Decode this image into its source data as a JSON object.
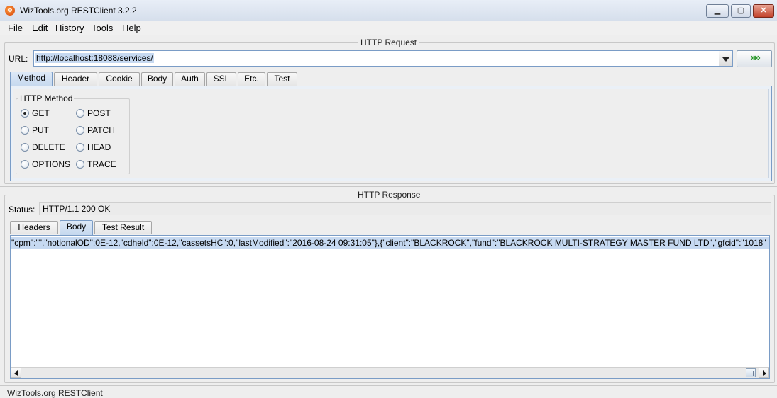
{
  "window": {
    "title": "WizTools.org RESTClient 3.2.2",
    "buttons": {
      "minimize": "▁",
      "maximize": "▢",
      "close": "✕"
    }
  },
  "menu": {
    "items": [
      "File",
      "Edit",
      "History",
      "Tools",
      "Help"
    ]
  },
  "request": {
    "section_title": "HTTP Request",
    "url_label": "URL:",
    "url_value": "http://localhost:18088/services/",
    "go_label": "»»",
    "tabs": [
      "Method",
      "Header",
      "Cookie",
      "Body",
      "Auth",
      "SSL",
      "Etc.",
      "Test"
    ],
    "active_tab": "Method",
    "method_group_title": "HTTP Method",
    "methods": [
      "GET",
      "POST",
      "PUT",
      "PATCH",
      "DELETE",
      "HEAD",
      "OPTIONS",
      "TRACE"
    ],
    "selected_method": "GET"
  },
  "response": {
    "section_title": "HTTP Response",
    "status_label": "Status:",
    "status_value": "HTTP/1.1 200 OK",
    "tabs": [
      "Headers",
      "Body",
      "Test Result"
    ],
    "active_tab": "Body",
    "body_text": "\"cpm\":\"\",\"notionalOD\":0E-12,\"cdheld\":0E-12,\"cassetsHC\":0,\"lastModified\":\"2016-08-24 09:31:05\"},{\"client\":\"BLACKROCK\",\"fund\":\"BLACKROCK MULTI-STRATEGY MASTER FUND LTD\",\"gfcid\":\"1018\""
  },
  "statusbar": {
    "text": "WizTools.org RESTClient"
  },
  "colors": {
    "accent": "#7a9cc6",
    "selection": "#c6d9f1",
    "go_arrow": "#2f9a2f"
  }
}
